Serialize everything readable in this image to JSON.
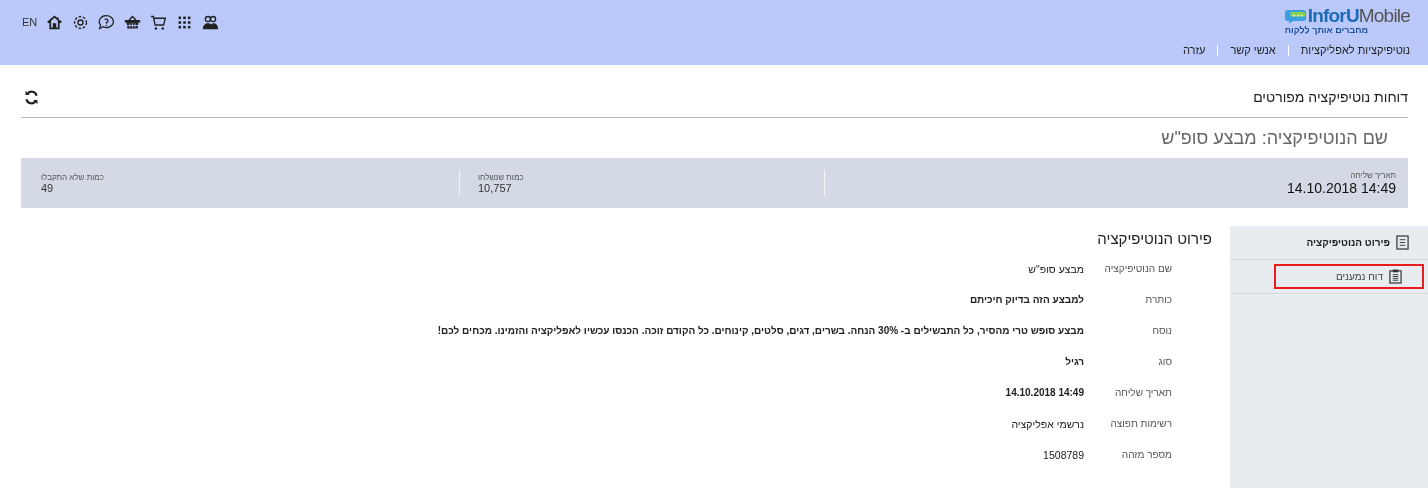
{
  "header": {
    "logo": {
      "brand_part1": "InforU",
      "brand_part2": "Mobile",
      "tagline": "מחברים אותך ללקוח"
    },
    "nav": [
      "נוטיפיקציות לאפליקציות",
      "אנשי קשר",
      "עזרה"
    ],
    "language": "EN"
  },
  "page_title": "דוחות נוטיפיקציה מפורטים",
  "notification_name": "שם הנוטיפיקציה: מבצע סופ\"ש",
  "stats": [
    {
      "label": "תאריך שליחה",
      "value": "14.10.2018 14:49",
      "kind": "large"
    },
    {
      "label": "כמות שנשלחו",
      "value": "10,757",
      "kind": "small"
    },
    {
      "label": "כמות שלא התקבלו",
      "value": "49",
      "kind": "small"
    }
  ],
  "sidebar": {
    "items": [
      {
        "label": "פירוט הנוטיפיקציה",
        "selected": true,
        "highlighted": false
      },
      {
        "label": "דוח נמענים",
        "selected": false,
        "highlighted": true
      }
    ]
  },
  "details": {
    "title": "פירוט הנוטיפיקציה",
    "rows": [
      {
        "label": "שם הנוטיפיקציה",
        "value": "מבצע סופ\"ש",
        "bold": false
      },
      {
        "label": "כותרת",
        "value": "למבצע הזה בדיוק חיכיתם",
        "bold": true
      },
      {
        "label": "נוסח",
        "value": "מבצע סופש טרי מהסיר, כל התבשילים ב- 30% הנחה. בשרים, דגים, סלטים, קינוחים. כל הקודם זוכה. הכנסו עכשיו לאפליקציה והזמינו. מכחים לכם!",
        "bold": true
      },
      {
        "label": "סוג",
        "value": "רגיל",
        "bold": true
      },
      {
        "label": "תאריך שליחה",
        "value": "14.10.2018 14:49",
        "bold": true
      },
      {
        "label": "רשימות תפוצה",
        "value": "נרשמי אפליקציה",
        "bold": false
      },
      {
        "label": "מספר מזהה",
        "value": "1508789",
        "bold": false
      }
    ]
  }
}
